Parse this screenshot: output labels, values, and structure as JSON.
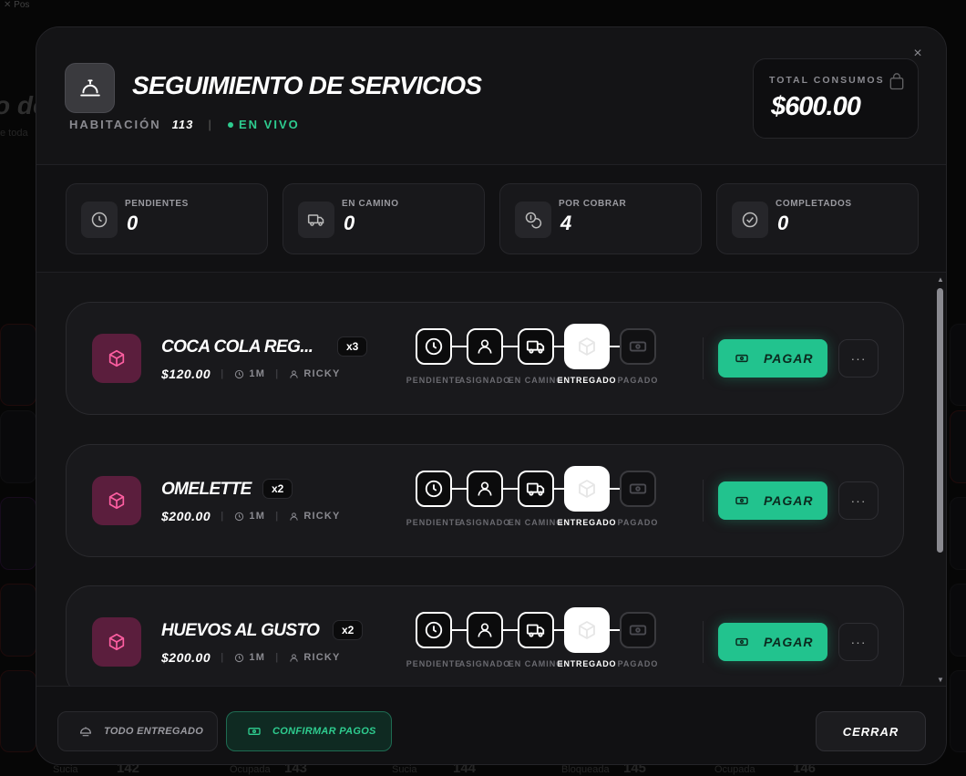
{
  "background": {
    "topbar_text": "Pos",
    "title_fragment": "o de",
    "sub_fragment": "e toda",
    "footer_labels": [
      "Sucia",
      "142",
      "Ocupada",
      "143",
      "Sucia",
      "144",
      "Bloqueada",
      "145",
      "Ocupada",
      "146"
    ]
  },
  "modal": {
    "title": "SEGUIMIENTO DE SERVICIOS",
    "room_label": "HABITACIÓN",
    "room_number": "113",
    "separator": "|",
    "live_label": "EN VIVO",
    "close_glyph": "×",
    "total_label": "TOTAL CONSUMOS",
    "total_value": "$600.00"
  },
  "stats": [
    {
      "label": "PENDIENTES",
      "value": "0",
      "icon": "clock-icon"
    },
    {
      "label": "EN CAMINO",
      "value": "0",
      "icon": "truck-icon"
    },
    {
      "label": "POR COBRAR",
      "value": "4",
      "icon": "coins-icon"
    },
    {
      "label": "COMPLETADOS",
      "value": "0",
      "icon": "check-circle-icon"
    }
  ],
  "steps": [
    "PENDIENTE",
    "ASIGNADO",
    "EN CAMINO",
    "ENTREGADO",
    "PAGADO"
  ],
  "active_step": "ENTREGADO",
  "orders": [
    {
      "name": "COCA COLA REG...",
      "qty": "x3",
      "price": "$120.00",
      "time": "1M",
      "staff": "RICKY",
      "pay_label": "PAGAR",
      "more": "···"
    },
    {
      "name": "OMELETTE",
      "qty": "x2",
      "price": "$200.00",
      "time": "1M",
      "staff": "RICKY",
      "pay_label": "PAGAR",
      "more": "···"
    },
    {
      "name": "HUEVOS AL GUSTO",
      "qty": "x2",
      "price": "$200.00",
      "time": "1M",
      "staff": "RICKY",
      "pay_label": "PAGAR",
      "more": "···"
    }
  ],
  "footer": {
    "all_delivered": "TODO ENTREGADO",
    "confirm_payments": "CONFIRMAR PAGOS",
    "close": "CERRAR"
  },
  "colors": {
    "accent_green": "#22c38e",
    "product_icon_bg": "#5b1e3d",
    "live_green": "#2ecc8f"
  }
}
